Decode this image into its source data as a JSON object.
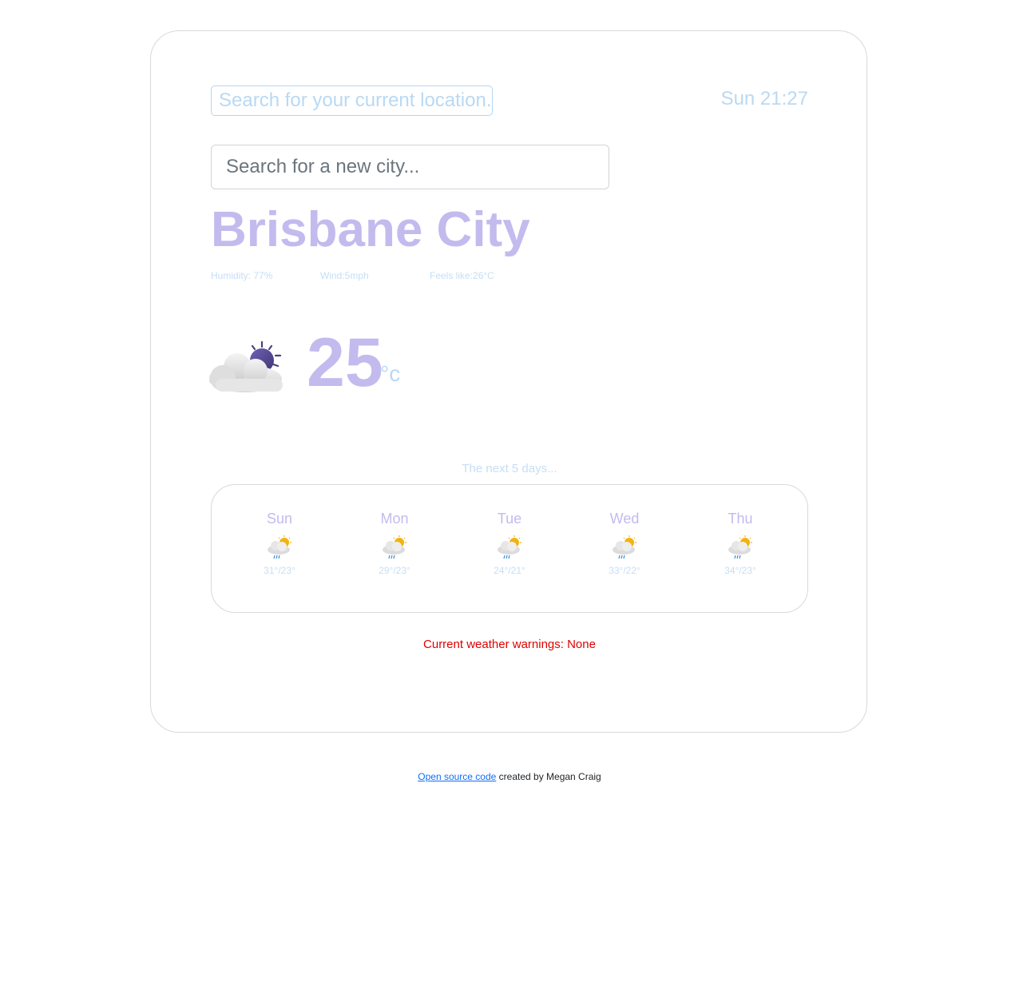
{
  "header": {
    "location_button_label": "Search for your current location...",
    "date_time": "Sun 21:27"
  },
  "search": {
    "placeholder": "Search for a new city..."
  },
  "current": {
    "city": "Brisbane City",
    "humidity": "Humidity: 77%",
    "wind": "Wind:5mph",
    "feels_like": "Feels like:26°C",
    "temperature": "25",
    "unit": "°c",
    "icon": "partly-cloudy-night-icon"
  },
  "forecast": {
    "heading": "The next 5 days...",
    "days": [
      {
        "day": "Sun",
        "temps": "31°/23°",
        "icon": "sun-cloud-rain-icon"
      },
      {
        "day": "Mon",
        "temps": "29°/23°",
        "icon": "sun-cloud-rain-icon"
      },
      {
        "day": "Tue",
        "temps": "24°/21°",
        "icon": "sun-cloud-rain-icon"
      },
      {
        "day": "Wed",
        "temps": "33°/22°",
        "icon": "sun-cloud-rain-icon"
      },
      {
        "day": "Thu",
        "temps": "34°/23°",
        "icon": "sun-cloud-rain-icon"
      }
    ]
  },
  "warnings": {
    "text": "Current weather warnings: None"
  },
  "footer": {
    "link_text": "Open source code",
    "suffix": " created by Megan Craig"
  },
  "colors": {
    "accent_purple": "#c3bbee",
    "accent_blue": "#b9d9f3",
    "warning_red": "#e00000",
    "link_blue": "#0d6efd"
  }
}
